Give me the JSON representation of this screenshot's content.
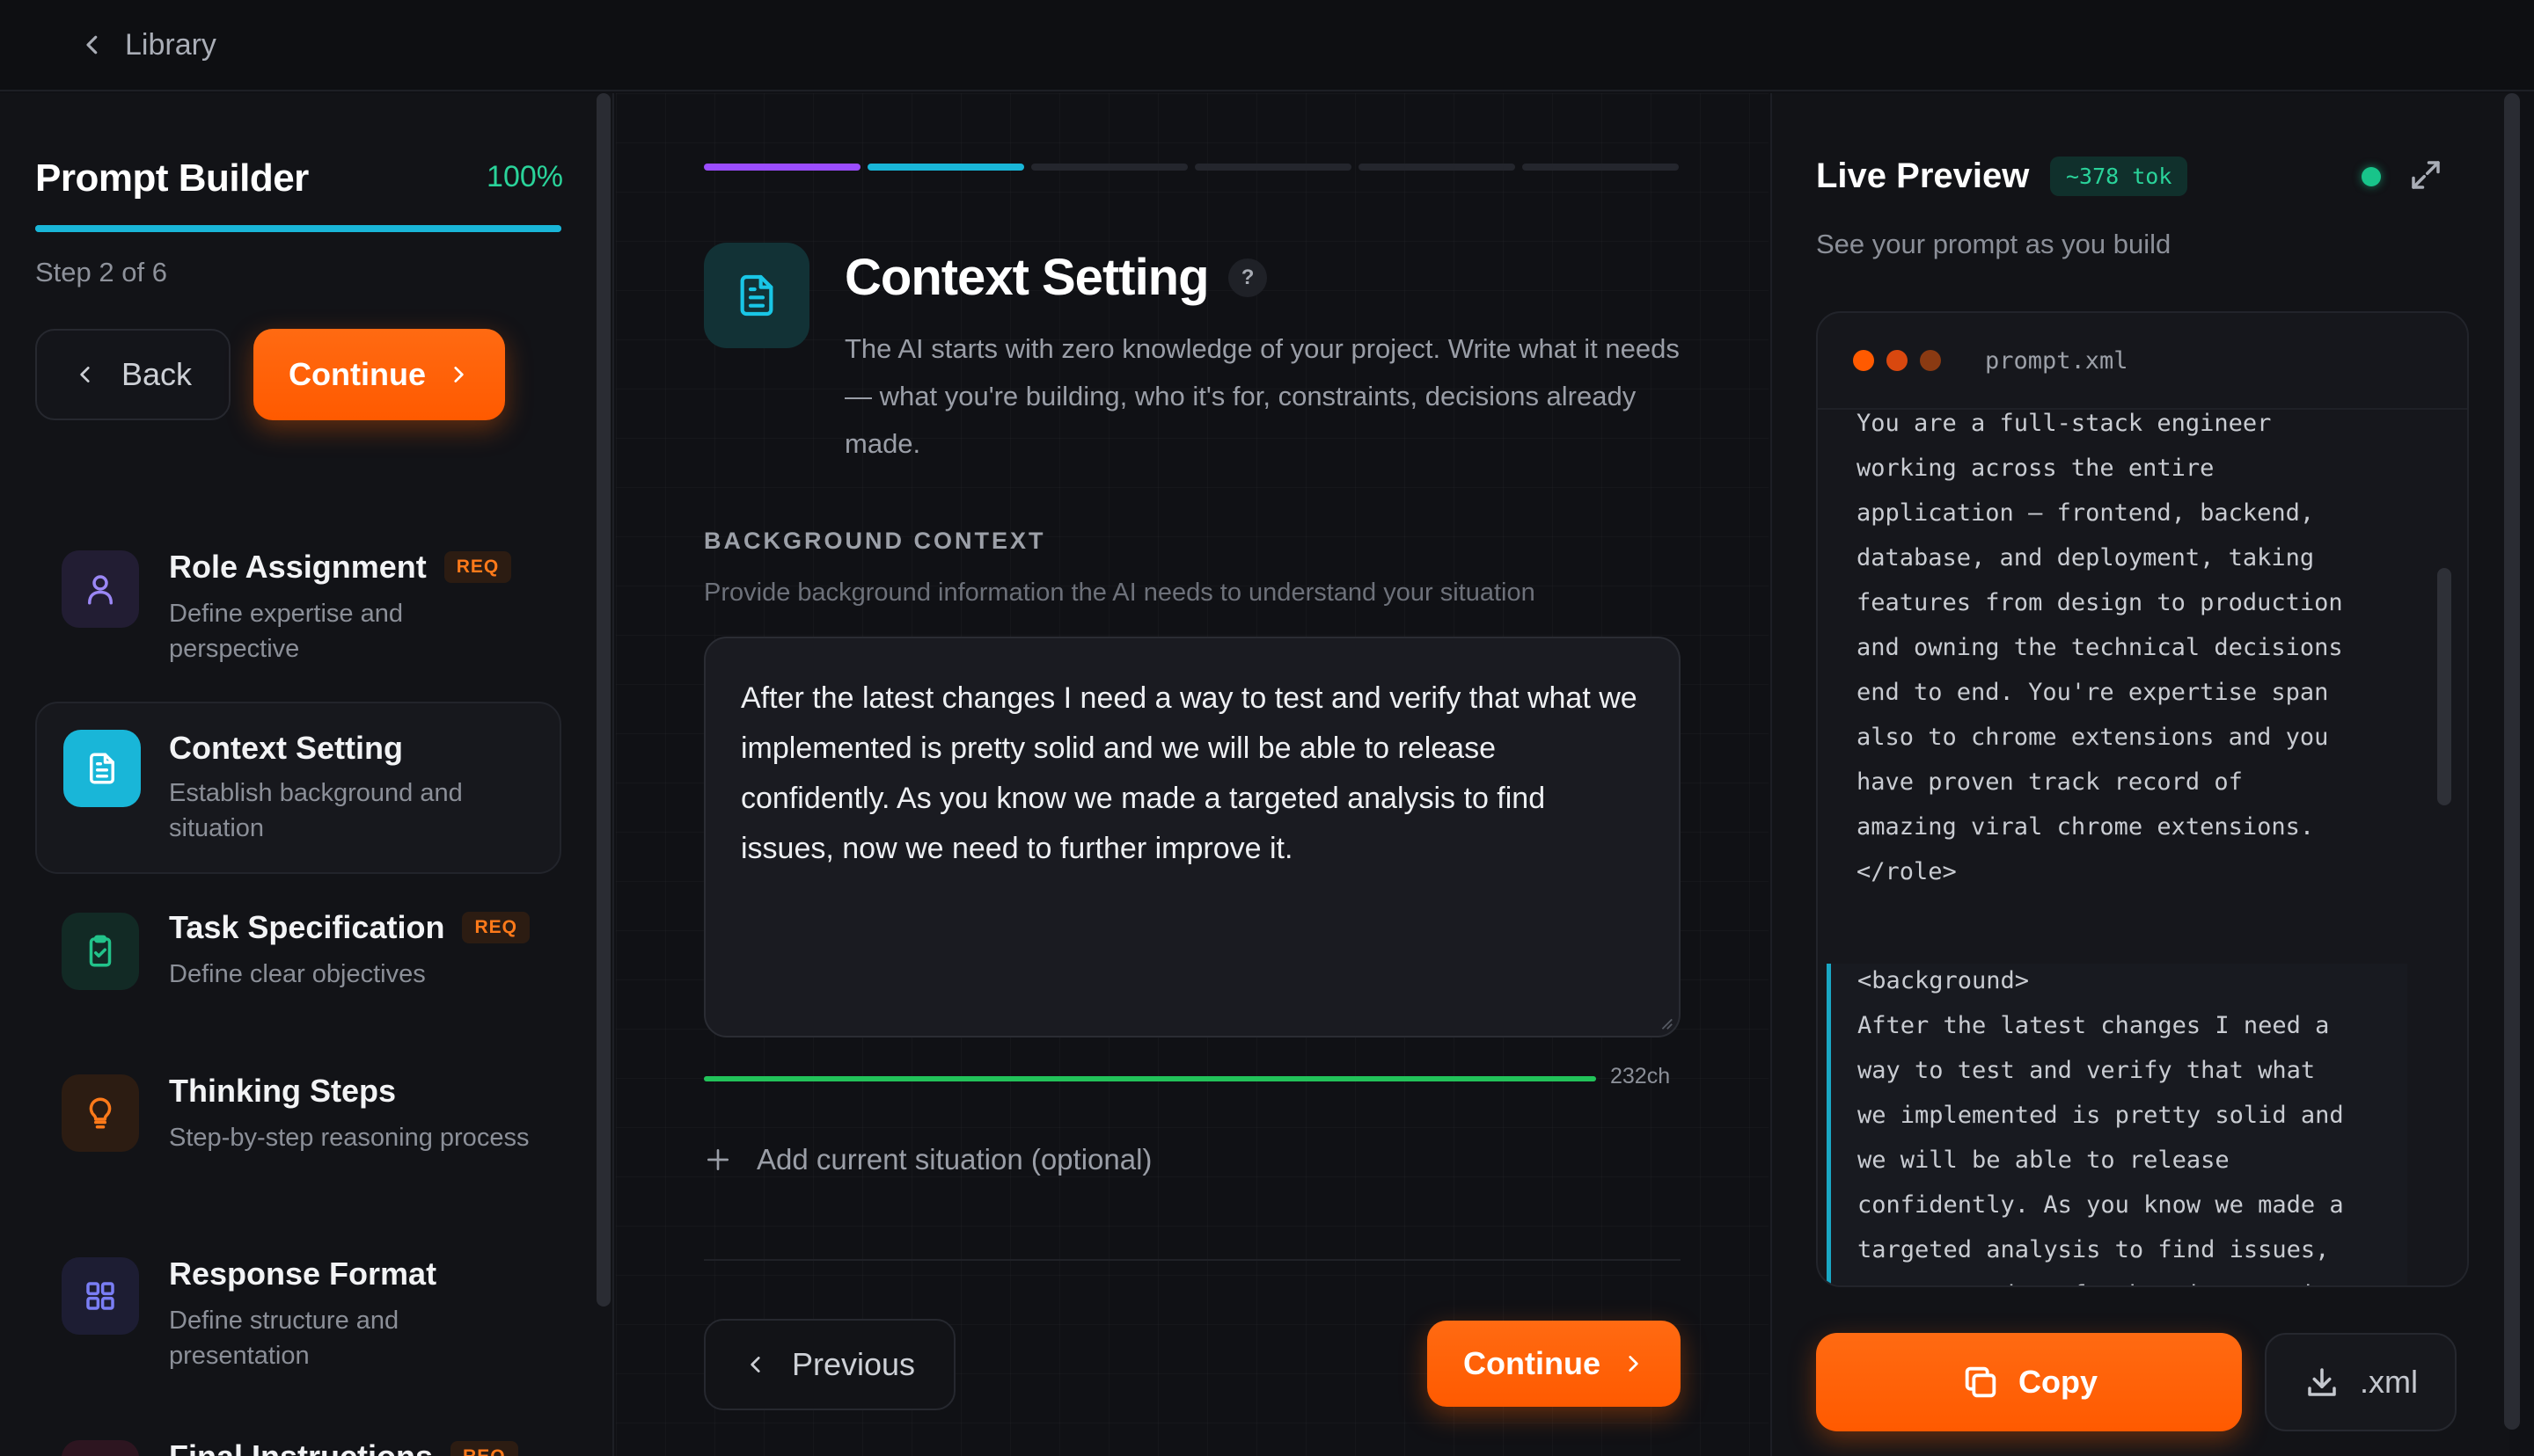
{
  "topbar": {
    "back_label": "Library"
  },
  "sidebar": {
    "title": "Prompt Builder",
    "percent": "100%",
    "progress": 1.0,
    "step_label": "Step 2 of 6",
    "back_label": "Back",
    "continue_label": "Continue",
    "steps": [
      {
        "title": "Role Assignment",
        "badge": "REQ",
        "desc": "Define expertise and perspective",
        "icon": "person-icon",
        "active": false
      },
      {
        "title": "Context Setting",
        "badge": "",
        "desc": "Establish background and situation",
        "icon": "document-icon",
        "active": true
      },
      {
        "title": "Task Specification",
        "badge": "REQ",
        "desc": "Define clear objectives",
        "icon": "clipboard-check-icon",
        "active": false
      },
      {
        "title": "Thinking Steps",
        "badge": "",
        "desc": "Step-by-step reasoning process",
        "icon": "lightbulb-icon",
        "active": false
      },
      {
        "title": "Response Format",
        "badge": "",
        "desc": "Define structure and presentation",
        "icon": "grid-icon",
        "active": false
      },
      {
        "title": "Final Instructions",
        "badge": "REQ",
        "desc": "",
        "icon": "send-icon",
        "active": false
      }
    ]
  },
  "main": {
    "title": "Context Setting",
    "help": "?",
    "description": "The AI starts with zero knowledge of your project. Write what it needs — what you're building, who it's for, constraints, decisions already made.",
    "section_label": "BACKGROUND CONTEXT",
    "section_sub": "Provide background information the AI needs to understand your situation",
    "textarea_value": "After the latest changes I need a way to test and verify that what we implemented is pretty solid and we will be able to release confidently. As you know we made a targeted analysis to find issues, now we need to further improve it.",
    "char_count": "232ch",
    "char_fill": 1.0,
    "add_situation": "Add current situation (optional)",
    "previous_label": "Previous",
    "continue_label": "Continue",
    "segments_done": 2,
    "segments_total": 6
  },
  "preview": {
    "title": "Live Preview",
    "token_badge": "~378 tok",
    "subtitle": "See your prompt as you build",
    "filename": "prompt.xml",
    "role_text": "You are a full-stack engineer\nworking across the entire\napplication — frontend, backend,\ndatabase, and deployment, taking\nfeatures from design to production\nand owning the technical decisions\nend to end. You're expertise span\nalso to chrome extensions and you\nhave proven track record of\namazing viral chrome extensions.\n</role>",
    "background_text": "<background>\nAfter the latest changes I need a\nway to test and verify that what\nwe implemented is pretty solid and\nwe will be able to release\nconfidently. As you know we made a\ntargeted analysis to find issues,\nnow we need to further improve it.",
    "copy_label": "Copy",
    "download_label": ".xml"
  },
  "colors": {
    "accent": "#ff5f0a",
    "teal": "#19b6d8",
    "green": "#2ad39a"
  }
}
